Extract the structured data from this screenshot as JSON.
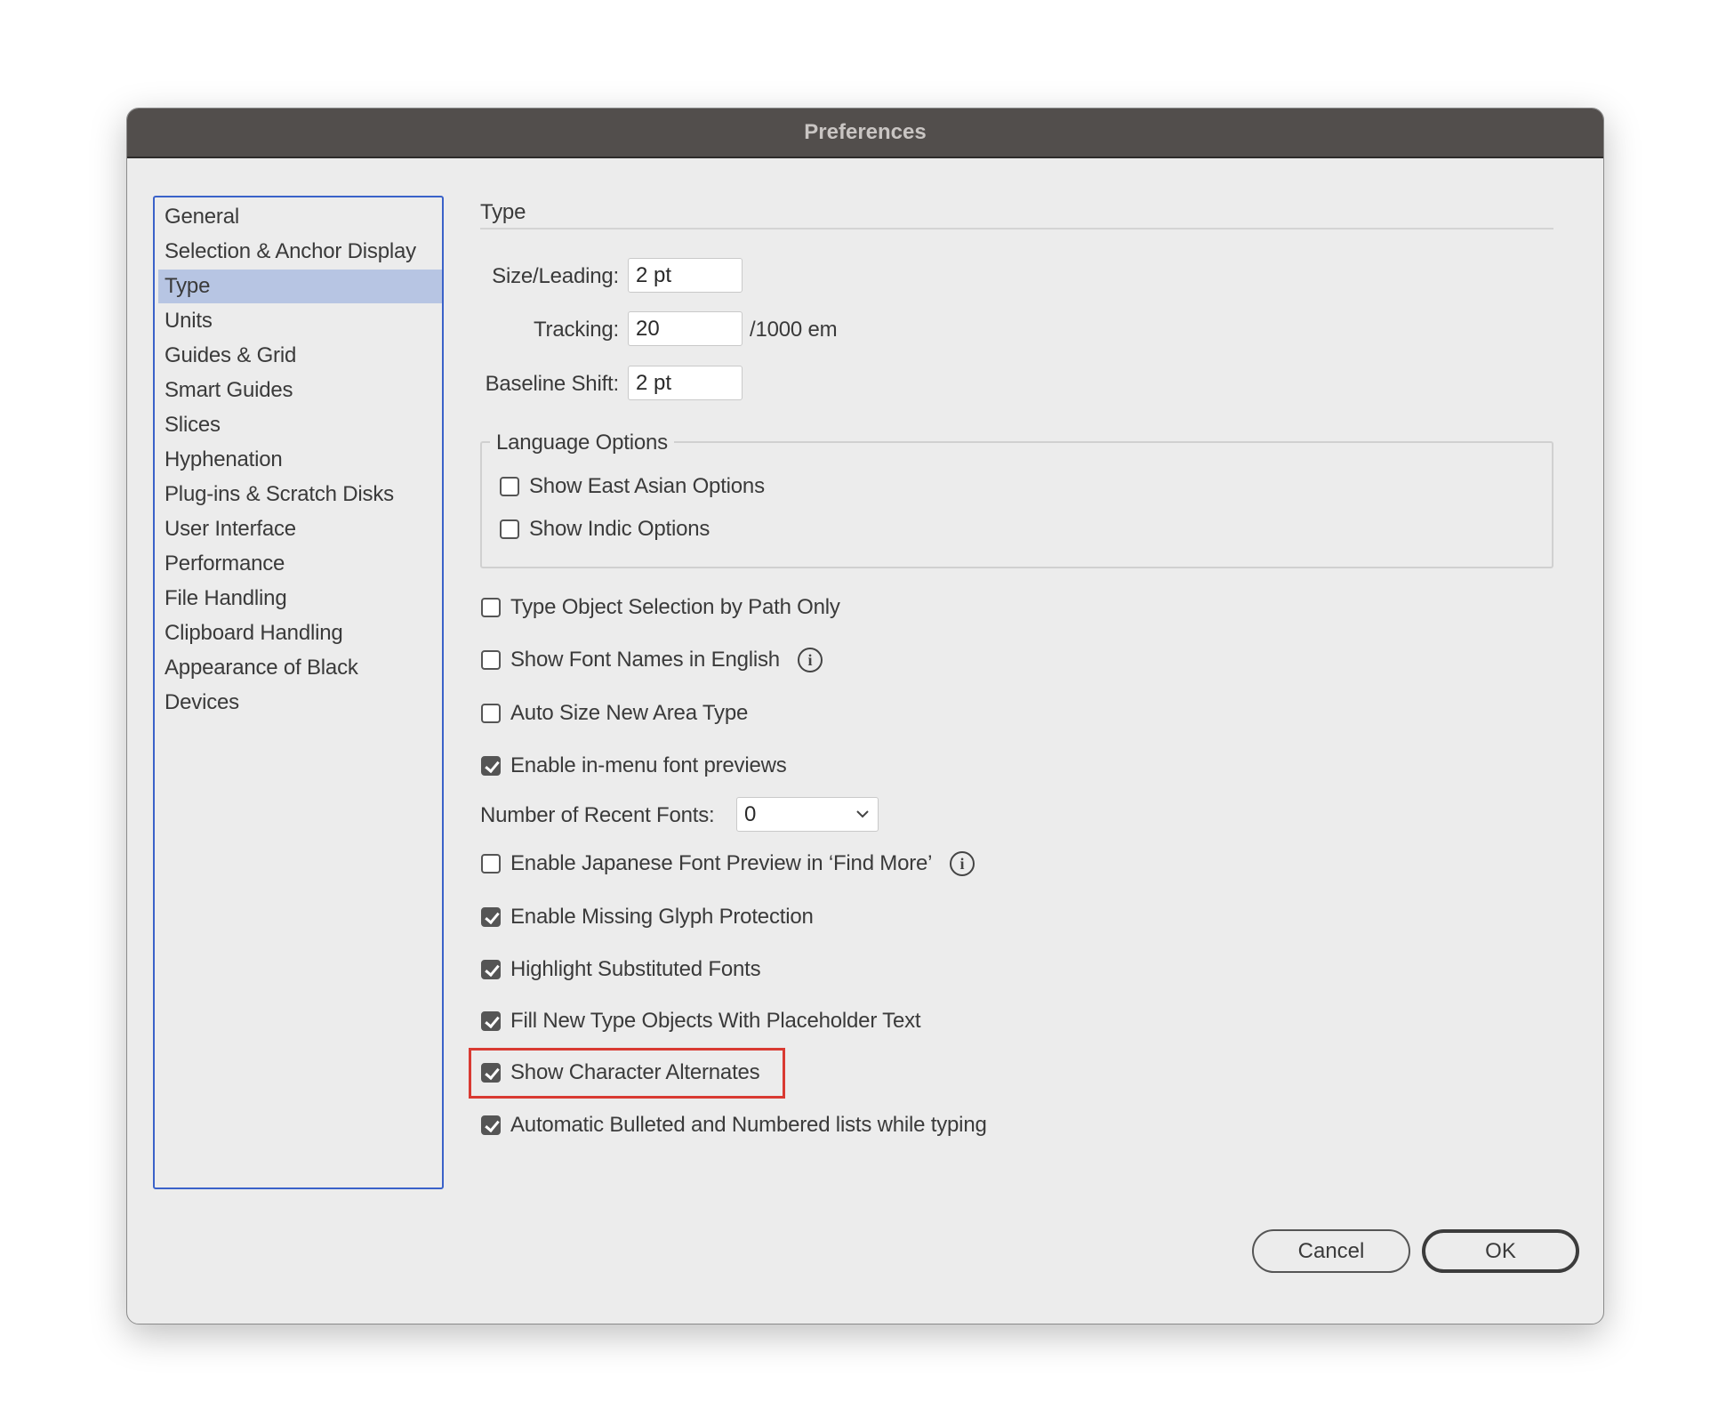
{
  "window": {
    "title": "Preferences"
  },
  "sidebar": {
    "items": [
      "General",
      "Selection & Anchor Display",
      "Type",
      "Units",
      "Guides & Grid",
      "Smart Guides",
      "Slices",
      "Hyphenation",
      "Plug-ins & Scratch Disks",
      "User Interface",
      "Performance",
      "File Handling",
      "Clipboard Handling",
      "Appearance of Black",
      "Devices"
    ],
    "selected": "Type"
  },
  "main": {
    "section_title": "Type",
    "size_leading": {
      "label": "Size/Leading:",
      "value": "2 pt"
    },
    "tracking": {
      "label": "Tracking:",
      "value": "20",
      "unit": "/1000 em"
    },
    "baseline_shift": {
      "label": "Baseline Shift:",
      "value": "2 pt"
    },
    "language_options": {
      "legend": "Language Options",
      "items": [
        {
          "label": "Show East Asian Options",
          "checked": false
        },
        {
          "label": "Show Indic Options",
          "checked": false
        }
      ]
    },
    "options": [
      {
        "label": "Type Object Selection by Path Only",
        "checked": false
      },
      {
        "label": "Show Font Names in English",
        "checked": false,
        "info": true
      },
      {
        "label": "Auto Size New Area Type",
        "checked": false
      },
      {
        "label": "Enable in-menu font previews",
        "checked": true
      }
    ],
    "recent_fonts": {
      "label": "Number of Recent Fonts:",
      "value": "0"
    },
    "options2": [
      {
        "label": "Enable Japanese Font Preview in ‘Find More’",
        "checked": false,
        "info": true
      },
      {
        "label": "Enable Missing Glyph Protection",
        "checked": true
      },
      {
        "label": "Highlight Substituted Fonts",
        "checked": true
      },
      {
        "label": "Fill New Type Objects With Placeholder Text",
        "checked": true
      },
      {
        "label": "Show Character Alternates",
        "checked": true,
        "highlighted": true
      },
      {
        "label": "Automatic Bulleted and Numbered lists while typing",
        "checked": true
      }
    ],
    "highlight_color": "#d93a32"
  },
  "buttons": {
    "cancel": "Cancel",
    "ok": "OK"
  }
}
